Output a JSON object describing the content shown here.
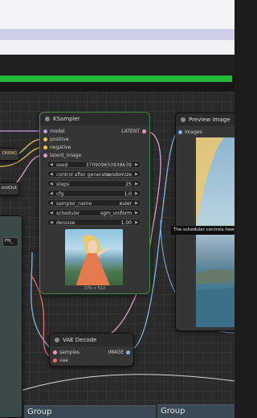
{
  "progress": {
    "fraction": 0.99
  },
  "ksampler": {
    "title": "KSampler",
    "inputs": [
      "model",
      "positive",
      "negative",
      "latent_image"
    ],
    "output": "LATENT",
    "widgets": [
      {
        "label": "seed",
        "value": "370909650938639"
      },
      {
        "label": "control after generate",
        "value": "randomize"
      },
      {
        "label": "steps",
        "value": "25"
      },
      {
        "label": "cfg",
        "value": "1.0"
      },
      {
        "label": "sampler_name",
        "value": "euler"
      },
      {
        "label": "scheduler",
        "value": "sgm_uniform"
      },
      {
        "label": "denoise",
        "value": "1.00"
      }
    ],
    "preview_caption": "376 × 512"
  },
  "preview": {
    "title": "Preview Image",
    "input": "images"
  },
  "vae": {
    "title": "VAE Decode",
    "inputs": [
      "samples",
      "vae"
    ],
    "output": "IMAGE"
  },
  "tooltip": "The scheduler controls how noise is gradually removed to form the image.",
  "partial_labels": {
    "conditioning": "ONING",
    "zeroout": "eroOut",
    "fn": "FN_"
  },
  "groups": [
    "Group",
    "Group"
  ],
  "colors": {
    "progress": "#23b83a",
    "ksampler_border": "#3f8a3f",
    "model_port": "#b39ddb",
    "cond_port": "#e8c15a",
    "latent_port": "#e59ac8",
    "image_port": "#7fb5e6",
    "vae_port": "#f06a6a"
  }
}
